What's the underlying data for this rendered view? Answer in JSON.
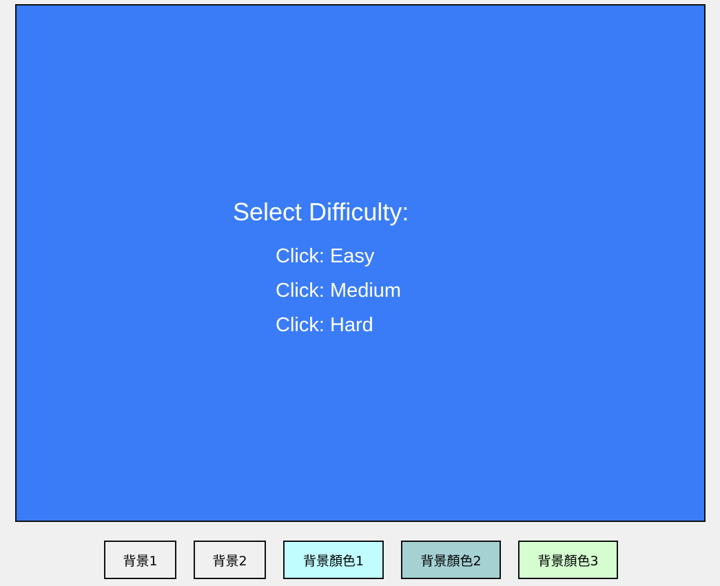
{
  "game": {
    "background_color": "#3a7cf8",
    "text_color": "#ffffff",
    "menu": {
      "title": "Select Difficulty:",
      "options": [
        "Click: Easy",
        "Click: Medium",
        "Click: Hard"
      ]
    }
  },
  "controls": {
    "buttons": [
      {
        "label": "背景1",
        "color": "#f0f0f0"
      },
      {
        "label": "背景2",
        "color": "#f0f0f0"
      },
      {
        "label": "背景顏色1",
        "color": "#c0fdfe"
      },
      {
        "label": "背景顏色2",
        "color": "#a5d1d3"
      },
      {
        "label": "背景顏色3",
        "color": "#d5fdd0"
      }
    ]
  }
}
